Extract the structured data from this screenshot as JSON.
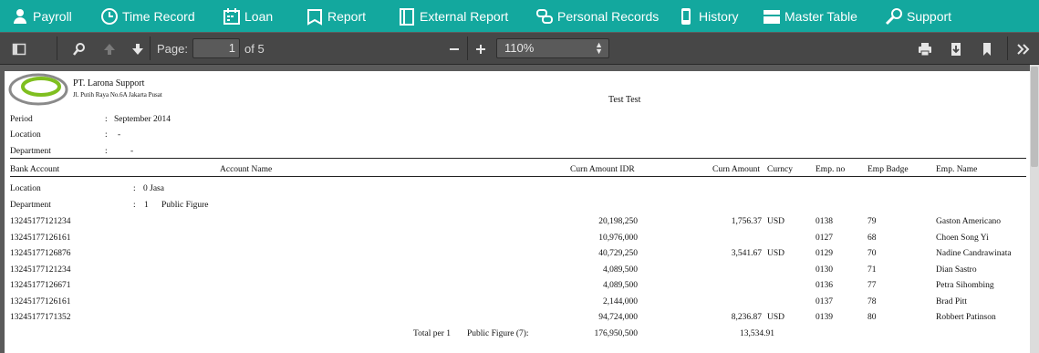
{
  "nav": {
    "items": [
      {
        "label": "Payroll",
        "icon": "user-icon"
      },
      {
        "label": "Time Record",
        "icon": "clock-icon"
      },
      {
        "label": "Loan",
        "icon": "calendar-icon"
      },
      {
        "label": "Report",
        "icon": "book-icon"
      },
      {
        "label": "External Report",
        "icon": "notebook-icon"
      },
      {
        "label": "Personal Records",
        "icon": "link-icon"
      },
      {
        "label": "History",
        "icon": "mobile-icon"
      },
      {
        "label": "Master Table",
        "icon": "table-icon"
      },
      {
        "label": "Support",
        "icon": "wrench-icon"
      }
    ],
    "color": "#13a89e"
  },
  "pdf_toolbar": {
    "page_label": "Page:",
    "page_value": "1",
    "page_total": "of 5",
    "zoom": "110%"
  },
  "report": {
    "company": "PT. Larona Support",
    "address": "Jl. Putih Raya No.6A Jakarta Pusat",
    "title": "Test Test",
    "period_label": "Period",
    "period_value": "September 2014",
    "location_label": "Location",
    "location_value": "-",
    "department_label": "Department",
    "department_value": "-",
    "colon": ":",
    "columns": [
      "Bank Account",
      "Account Name",
      "Curn Amount IDR",
      "Curn Amount",
      "Curncy",
      "Emp. no",
      "Emp Badge",
      "Emp. Name"
    ],
    "group_location_label": "Location",
    "group_location_value": "0 Jasa",
    "group_department_label": "Department",
    "group_department_no": "1",
    "group_department_name": "Public Figure",
    "rows": [
      {
        "bank": "13245177121234",
        "idr": "20,198,250",
        "amount": "1,756.37",
        "currency": "USD",
        "emp_no": "0138",
        "badge": "79",
        "name": "Gaston Americano"
      },
      {
        "bank": "13245177126161",
        "idr": "10,976,000",
        "amount": "",
        "currency": "",
        "emp_no": "0127",
        "badge": "68",
        "name": "Choen Song Yi"
      },
      {
        "bank": "13245177126876",
        "idr": "40,729,250",
        "amount": "3,541.67",
        "currency": "USD",
        "emp_no": "0129",
        "badge": "70",
        "name": "Nadine Candrawinata"
      },
      {
        "bank": "13245177121234",
        "idr": "4,089,500",
        "amount": "",
        "currency": "",
        "emp_no": "0130",
        "badge": "71",
        "name": "Dian Sastro"
      },
      {
        "bank": "13245177126671",
        "idr": "4,089,500",
        "amount": "",
        "currency": "",
        "emp_no": "0136",
        "badge": "77",
        "name": "Petra Sihombing"
      },
      {
        "bank": "13245177126161",
        "idr": "2,144,000",
        "amount": "",
        "currency": "",
        "emp_no": "0137",
        "badge": "78",
        "name": "Brad Pitt"
      },
      {
        "bank": "13245177171352",
        "idr": "94,724,000",
        "amount": "8,236.87",
        "currency": "USD",
        "emp_no": "0139",
        "badge": "80",
        "name": "Robbert Patinson"
      }
    ],
    "total_label": "Total per 1",
    "total_group": "Public Figure (7):",
    "total_idr": "176,950,500",
    "total_amount": "13,534.91"
  }
}
